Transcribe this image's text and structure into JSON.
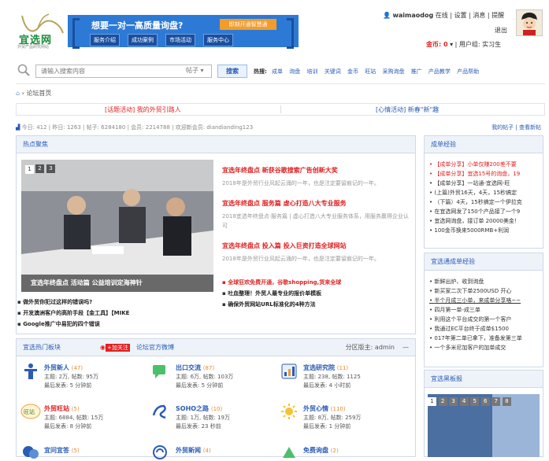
{
  "header": {
    "logo_text": "宜选网",
    "logo_sub": "外贸产品研究网站",
    "banner_question": "想要一对一高质量询盘?",
    "banner_button": "即刻开通智慧通",
    "banner_nav": [
      "服务介绍",
      "成功案例",
      "市场活动",
      "服务中心"
    ],
    "user": {
      "name": "waimaodog",
      "status": "在线",
      "links": [
        "设置",
        "消息",
        "提醒",
        "退出"
      ],
      "coins_label": "金币: 0",
      "group_label": "用户组: 实习生"
    }
  },
  "search": {
    "placeholder": "请输入搜索内容",
    "type": "帖子",
    "button": "搜索",
    "hot_label": "热搜:",
    "hot_items": [
      "成单",
      "询盘",
      "培训",
      "关键词",
      "金币",
      "旺站",
      "采购询盘",
      "推广",
      "产品教学",
      "产品帮助"
    ]
  },
  "breadcrumb": {
    "home": "论坛首页"
  },
  "topbar": {
    "left": "[话题活动] 我的外贸引路人",
    "right": "[心情活动] 新春\"新\"趣"
  },
  "stats": {
    "text": "今日: 412 | 昨日: 1263 | 帖子: 6284180 | 会员: 2214788 | 欢迎新会员: diandianding123",
    "right": "我的帖子 | 查看新帖"
  },
  "hot_panel": {
    "title": "热点聚焦",
    "slide_pages": [
      "1",
      "2",
      "3"
    ],
    "slide_caption": "宜选年终盘点 活动篇 公益培训定海神针",
    "news": [
      {
        "title": "宜选年终盘点 新获谷歌搜索广告创新大奖",
        "desc": "2018年是外贸行业风起云涌的一年，也是注定要留痕记的一年。"
      },
      {
        "title": "宜选年终盘点 服务篇 虚心打造八大专业服务",
        "desc": "2018宜选年终盘点·服务篇 | 虚心打造八大专业服务体系，用服务赢得企业认可"
      },
      {
        "title": "宜选年终盘点 投入篇 投入巨资打造全球网站",
        "desc": "2018年是外贸行业风起云涌的一年，也是注定要留痕记的一年。"
      }
    ],
    "bullets_right": [
      "全球狂欢免费开通，谷歌shopping,货来全球",
      "吐血整理！外贸人最专业的报价单模板",
      "确保外贸网站URL标准化的4种方法"
    ],
    "bullets_left": [
      "做外贸你犯过这样的错误吗?",
      "开发澳洲客户的高阶手段【金工具】【MIKE",
      "Google推广中易犯的四个错误"
    ]
  },
  "forum_panel": {
    "title": "宜选热门板块",
    "weibo_follow": "+加关注",
    "weibo_label": "论坛官方微博",
    "moderator": "分区版主: admin",
    "boards": [
      {
        "name": "外贸新人",
        "count": "(47)",
        "topics": "主题: 2万, 帖数: 95万",
        "last": "最后发表: 5 分钟前"
      },
      {
        "name": "出口交流",
        "count": "(87)",
        "topics": "主题: 6万, 帖数: 103万",
        "last": "最后发表: 5 分钟前"
      },
      {
        "name": "宜选研究院",
        "count": "(11)",
        "topics": "主题: 238, 帖数: 1125",
        "last": "最后发表: 4 小时前"
      },
      {
        "name": "外贸旺站",
        "count": "(5)",
        "topics": "主题: 6884, 帖数: 15万",
        "last": "最后发表: 8 分钟前"
      },
      {
        "name": "SOHO之路",
        "count": "(10)",
        "topics": "主题: 1万, 帖数: 19万",
        "last": "最后发表: 23 秒前"
      },
      {
        "name": "外贸心情",
        "count": "(110)",
        "topics": "主题: 8万, 帖数: 259万",
        "last": "最后发表: 1 分钟前"
      },
      {
        "name": "宜问宜答",
        "count": "(5)",
        "topics": "",
        "last": ""
      },
      {
        "name": "外贸新闻",
        "count": "(4)",
        "topics": "",
        "last": ""
      },
      {
        "name": "免费询盘",
        "count": "(2)",
        "topics": "",
        "last": ""
      }
    ]
  },
  "right": {
    "p1_title": "成单经验",
    "p1_items": [
      "【成单分享】小单仅赚200差不要",
      "【成单分享】宜选15号的询盘，19",
      "【成单分享】一站通-宜选网-旺",
      "(上篇)外贸16天，4天，15秒搞定",
      "（下篇）4天，15秒搞定一个伊拉克",
      "在宜选网发了150个产品接了一个9",
      "宜选网询盘，接订单 20000美金！",
      "100金币换来5000RMB+利润"
    ],
    "p2_title": "宜选通成单经验",
    "p2_items": [
      "新鲜出炉、收到询盘",
      "新买家二次下单2500USD 开心",
      "半个月成三小单，来成单分享咯~~",
      "四月第一单-成三单",
      "利用这个平台成交的第一个客户",
      "我通过EC平台终于成单$1500",
      "017年第二单已拿下，准备发第三单",
      "一个多米尼加客户的加单成交"
    ],
    "p3_title": "宜选黑板报",
    "p3_pages": [
      "1",
      "2",
      "3",
      "4",
      "5",
      "6",
      "7",
      "8"
    ]
  }
}
